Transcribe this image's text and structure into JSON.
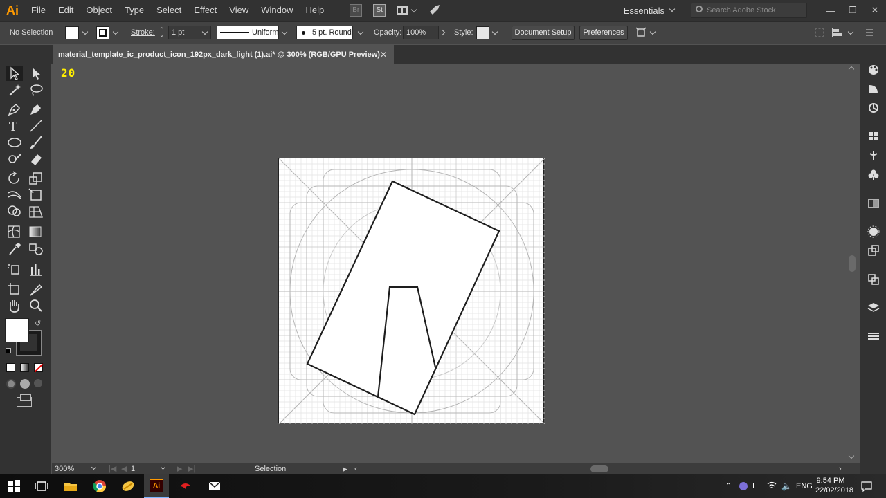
{
  "app": {
    "logo": "Ai",
    "accent": "#ff9a00"
  },
  "menu": [
    "File",
    "Edit",
    "Object",
    "Type",
    "Select",
    "Effect",
    "View",
    "Window",
    "Help"
  ],
  "bridge_label": "Br",
  "stock_label": "St",
  "workspace": "Essentials",
  "search": {
    "placeholder": "Search Adobe Stock"
  },
  "control": {
    "selection": "No Selection",
    "stroke_label": "Stroke:",
    "stroke_weight": "1 pt",
    "profile": "Uniform",
    "brush": "5 pt. Round",
    "opacity_label": "Opacity:",
    "opacity": "100%",
    "style_label": "Style:",
    "document_setup": "Document Setup",
    "preferences": "Preferences"
  },
  "document": {
    "tab_title": "material_template_ic_product_icon_192px_dark_light (1).ai* @ 300% (RGB/GPU Preview)",
    "close": "✕",
    "badge": "20"
  },
  "status": {
    "zoom": "300%",
    "artboard": "1",
    "tool": "Selection"
  },
  "taskbar": {
    "language": "ENG",
    "time": "9:54 PM",
    "date": "22/02/2018"
  },
  "colors": {
    "fill": "#ffffff",
    "stroke": "#1e1e1e",
    "ui_dark": "#323232",
    "canvas": "#535353"
  }
}
